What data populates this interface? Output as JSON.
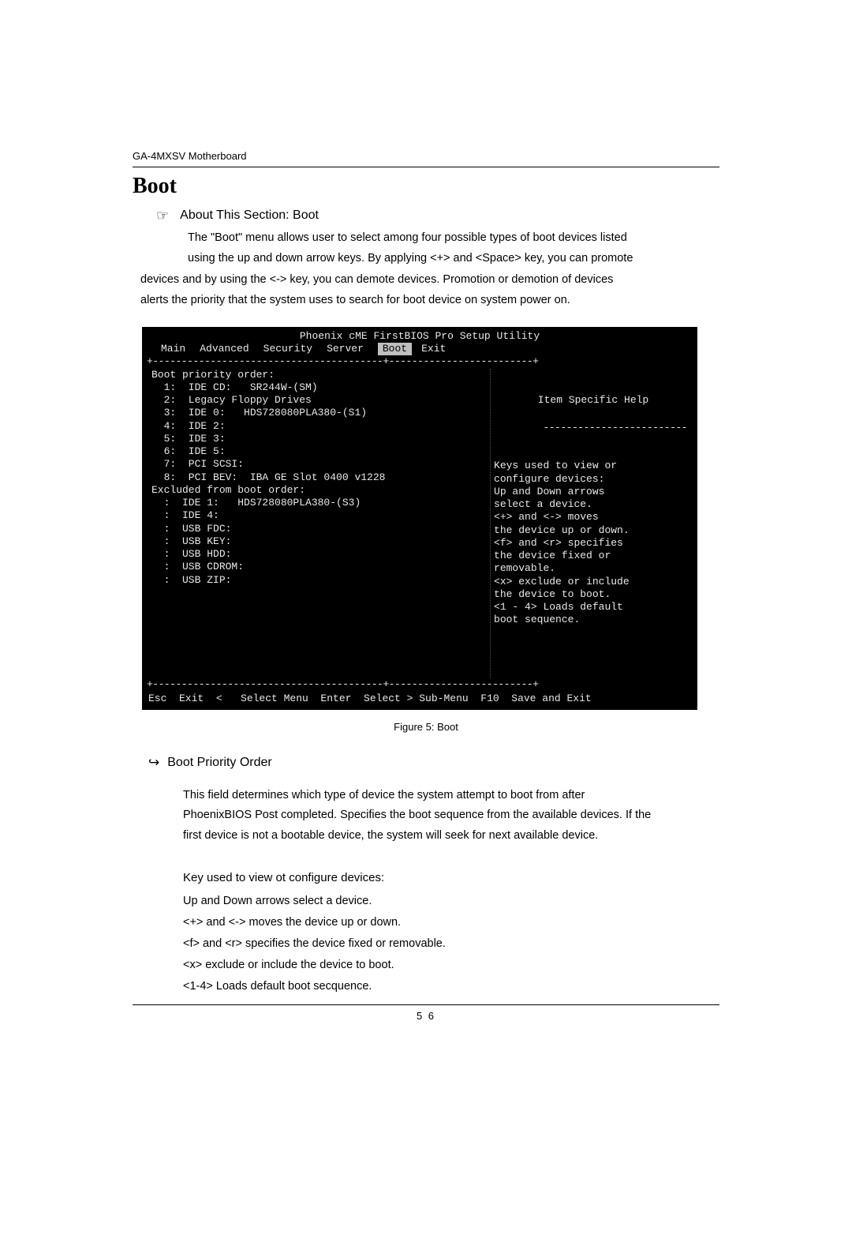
{
  "doc": {
    "header": "GA-4MXSV Motherboard",
    "title": "Boot",
    "about_label": "About This Section: Boot",
    "about_p1": "The \"Boot\" menu allows user to select among four possible types of boot devices listed",
    "about_p2": "using the up and down arrow keys. By applying <+> and <Space> key, you can promote",
    "about_p3": "devices and by using the <-> key, you can demote devices. Promotion or demotion of devices",
    "about_p4": "alerts the priority that the system uses to search for boot device on system power on.",
    "fig_caption": "Figure 5: Boot",
    "subheading": "Boot  Priority Order",
    "desc_p1": "This field determines which type of device the system attempt to boot from after",
    "desc_p2": "PhoenixBIOS Post completed. Specifies the boot sequence from the available devices. If the",
    "desc_p3": "first device is not a bootable device, the system will seek for next available device.",
    "key_heading": "Key used to view ot configure devices:",
    "k1": "Up and Down arrows select a device.",
    "k2": "<+> and <-> moves the device up or down.",
    "k3": "<f> and <r> specifies the device fixed or removable.",
    "k4": " <x> exclude or include the device to boot.",
    "k5": "<1-4> Loads default boot secquence.",
    "page_number": "5 6"
  },
  "bios": {
    "title": "Phoenix cME FirstBIOS Pro Setup Utility",
    "menu": {
      "m1": "Main",
      "m2": "Advanced",
      "m3": "Security",
      "m4": "Server",
      "m5": "Boot",
      "m6": "Exit"
    },
    "help_title": "Item Specific Help",
    "left_lines": [
      "Boot priority order:",
      "  1:  IDE CD:   SR244W-(SM)",
      "  2:  Legacy Floppy Drives",
      "  3:  IDE 0:   HDS728080PLA380-(S1)",
      "  4:  IDE 2:",
      "  5:  IDE 3:",
      "  6:  IDE 5:",
      "  7:  PCI SCSI:",
      "  8:  PCI BEV:  IBA GE Slot 0400 v1228",
      "Excluded from boot order:",
      "  :  IDE 1:   HDS728080PLA380-(S3)",
      "  :  IDE 4:",
      "  :  USB FDC:",
      "  :  USB KEY:",
      "  :  USB HDD:",
      "  :  USB CDROM:",
      "  :  USB ZIP:"
    ],
    "right_lines": [
      "",
      "Keys used to view or",
      "configure devices:",
      "Up and Down arrows",
      "select a device.",
      "<+> and <-> moves",
      "the device up or down.",
      "<f> and <r> specifies",
      "the device fixed or",
      "removable.",
      "<x> exclude or include",
      "the device to boot.",
      "<1 - 4> Loads default",
      "boot sequence.",
      "",
      "",
      ""
    ],
    "nav": "Esc  Exit  <   Select Menu  Enter  Select > Sub-Menu  F10  Save and Exit"
  }
}
